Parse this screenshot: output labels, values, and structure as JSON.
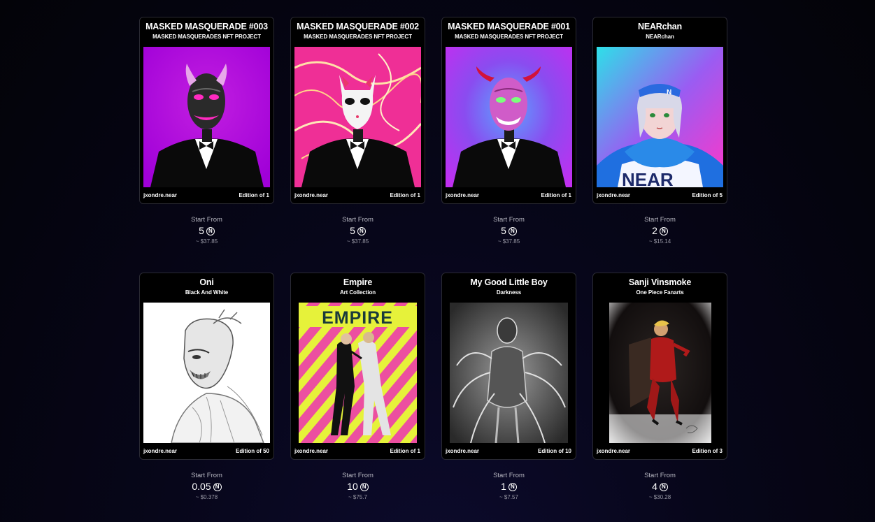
{
  "cards": [
    {
      "title": "MASKED MASQUERADE #003",
      "subtitle": "MASKED MASQUERADES NFT PROJECT",
      "owner": "jxondre.near",
      "edition": "Edition of 1",
      "price_label": "Start From",
      "price": "5",
      "usd": "~ $37.85",
      "art": "black oni mask figure in tuxedo on magenta background"
    },
    {
      "title": "MASKED MASQUERADE #002",
      "subtitle": "MASKED MASQUERADES NFT PROJECT",
      "owner": "jxondre.near",
      "edition": "Edition of 1",
      "price_label": "Start From",
      "price": "5",
      "usd": "~ $37.85",
      "art": "white fox mask figure in tuxedo on pink swirl background"
    },
    {
      "title": "MASKED MASQUERADE #001",
      "subtitle": "MASKED MASQUERADES NFT PROJECT",
      "owner": "jxondre.near",
      "edition": "Edition of 1",
      "price_label": "Start From",
      "price": "5",
      "usd": "~ $37.85",
      "art": "pink oni mask figure in tuxedo on purple background"
    },
    {
      "title": "NEARchan",
      "subtitle": "NEARchan",
      "owner": "jxondre.near",
      "edition": "Edition of 5",
      "price_label": "Start From",
      "price": "2",
      "usd": "~ $15.14",
      "art": "anime girl in blue NEAR hoodie"
    },
    {
      "title": "Oni",
      "subtitle": "Black And White",
      "owner": "jxondre.near",
      "edition": "Edition of 50",
      "price_label": "Start From",
      "price": "0.05",
      "usd": "~ $0.378",
      "art": "pencil sketch of masked figure"
    },
    {
      "title": "Empire",
      "subtitle": "Art Collection",
      "owner": "jxondre.near",
      "edition": "Edition of 1",
      "price_label": "Start From",
      "price": "10",
      "usd": "~ $75.7",
      "art": "EMPIRE poster with dancing couple on pink and yellow stripes",
      "art_text": "EMPIRE"
    },
    {
      "title": "My Good Little Boy",
      "subtitle": "Darkness",
      "owner": "jxondre.near",
      "edition": "Edition of 10",
      "price_label": "Start From",
      "price": "1",
      "usd": "~ $7.57",
      "art": "dark grayscale creature with many arms"
    },
    {
      "title": "Sanji Vinsmoke",
      "subtitle": "One Piece Fanarts",
      "owner": "jxondre.near",
      "edition": "Edition of 3",
      "price_label": "Start From",
      "price": "4",
      "usd": "~ $30.28",
      "art": "man in red suit sitting on a chair smoking"
    }
  ],
  "currency_icon": "near-icon",
  "colors": {
    "background": "#07061a",
    "card_bg": "#000000",
    "card_border": "#2a2a33",
    "muted_text": "#b9b9c3"
  }
}
